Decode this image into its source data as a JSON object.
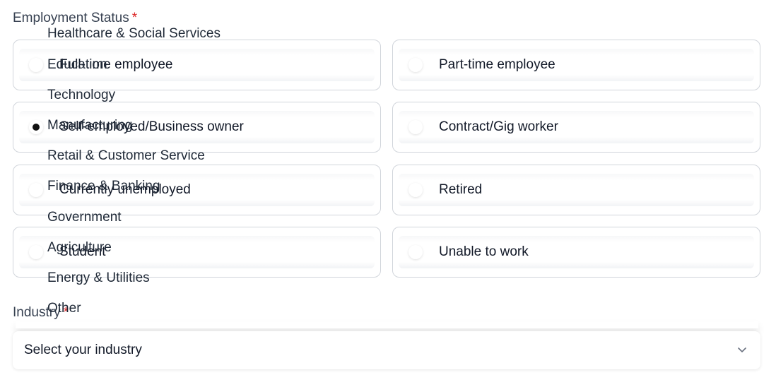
{
  "employment": {
    "label": "Employment Status",
    "required_mark": "*",
    "options": [
      {
        "label": "Full-time employee",
        "selected": false
      },
      {
        "label": "Part-time employee",
        "selected": false
      },
      {
        "label": "Self-employed/Business owner",
        "selected": true
      },
      {
        "label": "Contract/Gig worker",
        "selected": false
      },
      {
        "label": "Currently unemployed",
        "selected": false
      },
      {
        "label": "Retired",
        "selected": false
      },
      {
        "label": "Student",
        "selected": false
      },
      {
        "label": "Unable to work",
        "selected": false
      }
    ]
  },
  "industry": {
    "label": "Industry",
    "required_mark": "*",
    "placeholder": "Select your industry",
    "options": [
      "Healthcare & Social Services",
      "Education",
      "Technology",
      "Manufacturing",
      "Retail & Customer Service",
      "Finance & Banking",
      "Government",
      "Agriculture",
      "Energy & Utilities",
      "Other"
    ]
  },
  "icons": {
    "select_chevron": "chevron-down-icon"
  },
  "colors": {
    "required": "#dc2626",
    "border": "#d1d5db",
    "selected_dot": "#111111"
  }
}
